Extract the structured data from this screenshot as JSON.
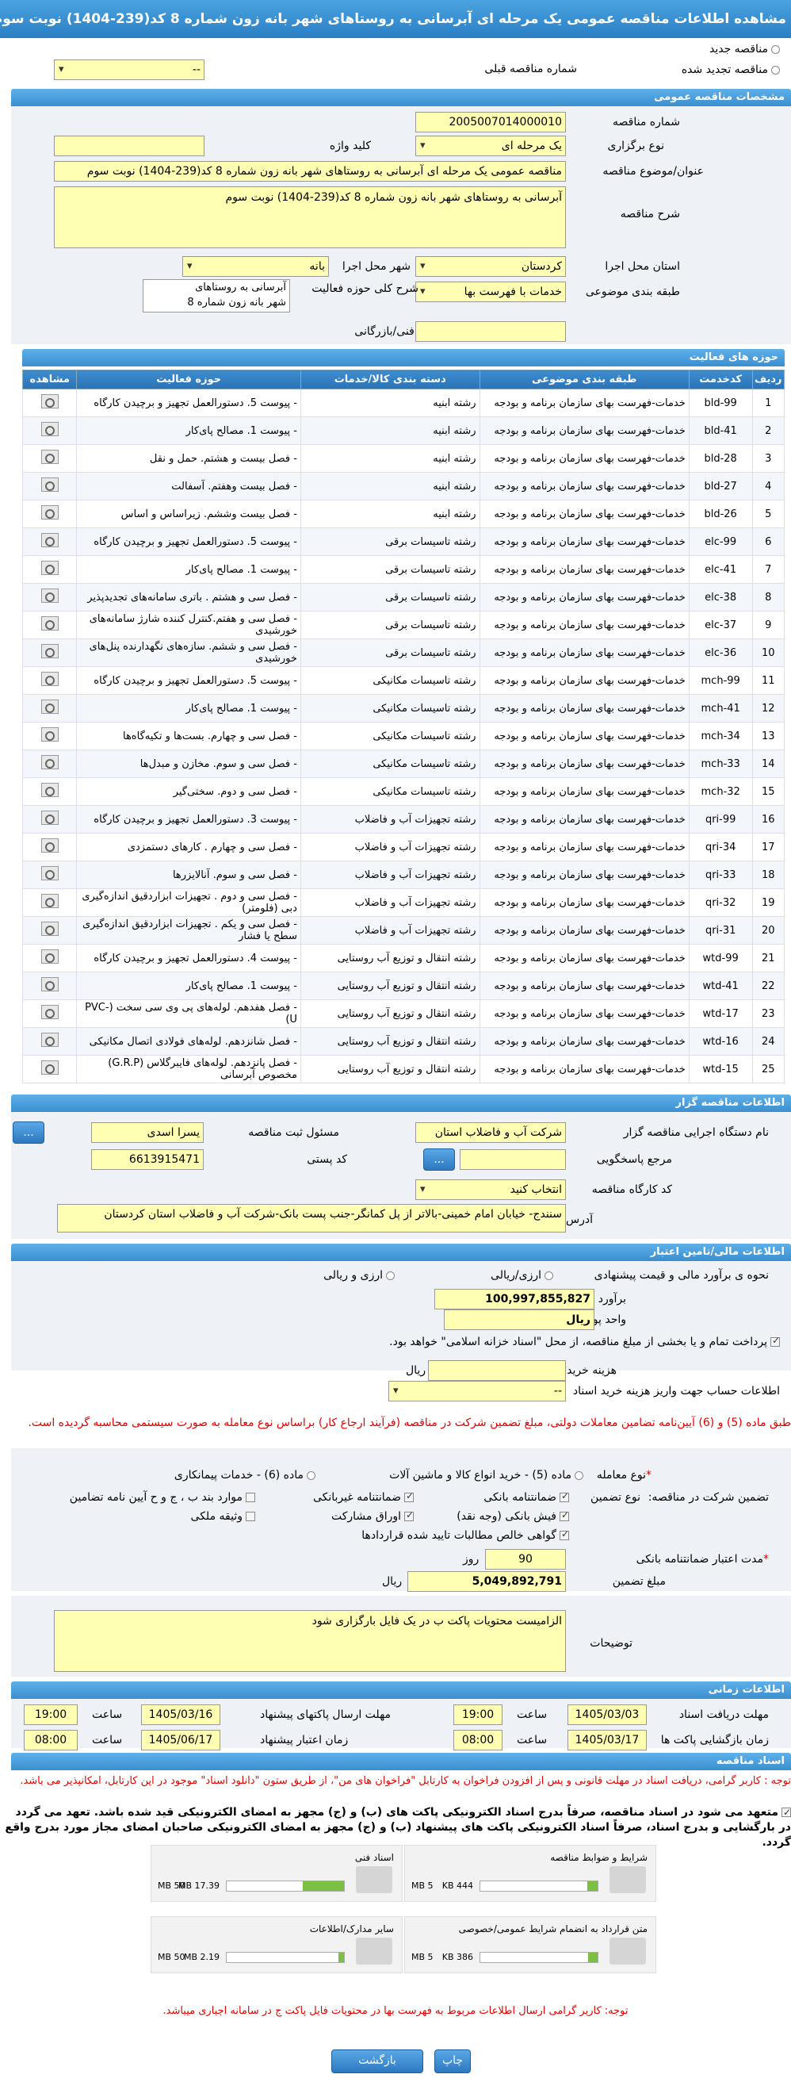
{
  "title": "مشاهده اطلاعات مناقصه عمومی یک مرحله ای آبرسانی به روستاهای شهر بانه زون شماره 8 کد(239-1404) نوبت سوم",
  "top": {
    "new_tender": "مناقصه جدید",
    "renewed_tender": "مناقصه تجدید شده",
    "prev_tender_label": "شماره مناقصه قبلی",
    "prev_tender_value": "--"
  },
  "general": {
    "section_title": "مشخصات مناقصه عمومی",
    "tender_number_label": "شماره مناقصه",
    "tender_number": "2005007014000010",
    "holding_type_label": "نوع برگزاری",
    "holding_type": "یک مرحله ای",
    "keyword_label": "کلید واژه",
    "keyword": "",
    "title_label": "عنوان/موضوع مناقصه",
    "title_value": "مناقصه عمومی یک مرحله ای آبرسانی به روستاهای شهر بانه زون شماره 8 کد(239-1404) نوبت سوم",
    "desc_label": "شرح مناقصه",
    "desc_value": "آبرسانی به روستاهای شهر بانه زون شماره 8 کد(239-1404) نوبت سوم",
    "province_label": "استان محل اجرا",
    "province": "کردستان",
    "city_label": "شهر محل اجرا",
    "city": "بانه",
    "category_label": "طبقه بندی موضوعی",
    "category": "خدمات با فهرست بها",
    "scope_label": "شرح کلی حوزه فعالیت",
    "scope_line1": "آبرسانی به روستاهای",
    "scope_line2": "شهر بانه زون شماره 8",
    "min_score_label": "حداقل امتیاز قابل قبول ارزیابی فنی/بازرگانی",
    "min_score": ""
  },
  "activities": {
    "section_title": "حوزه های فعالیت",
    "headers": [
      "ردیف",
      "کدخدمت",
      "طبقه بندی موضوعی",
      "دسته بندی کالا/خدمات",
      "حوزه فعالیت",
      "مشاهده"
    ],
    "rows": [
      [
        "1",
        "bld-99",
        "خدمات-فهرست بهای سازمان برنامه و بودجه",
        "رشته ابنیه",
        "- پیوست 5. دستورالعمل تجهیز و برچیدن کارگاه"
      ],
      [
        "2",
        "bld-41",
        "خدمات-فهرست بهای سازمان برنامه و بودجه",
        "رشته ابنیه",
        "- پیوست 1. مصالح پای‌کار"
      ],
      [
        "3",
        "bld-28",
        "خدمات-فهرست بهای سازمان برنامه و بودجه",
        "رشته ابنیه",
        "- فصل بیست و هشتم. حمل و نقل"
      ],
      [
        "4",
        "bld-27",
        "خدمات-فهرست بهای سازمان برنامه و بودجه",
        "رشته ابنیه",
        "- فصل بیست وهفتم. آسفالت"
      ],
      [
        "5",
        "bld-26",
        "خدمات-فهرست بهای سازمان برنامه و بودجه",
        "رشته ابنیه",
        "- فصل بیست وششم. زیراساس و اساس"
      ],
      [
        "6",
        "elc-99",
        "خدمات-فهرست بهای سازمان برنامه و بودجه",
        "رشته تاسیسات برقی",
        "- پیوست 5. دستورالعمل تجهیز و برچیدن کارگاه"
      ],
      [
        "7",
        "elc-41",
        "خدمات-فهرست بهای سازمان برنامه و بودجه",
        "رشته تاسیسات برقی",
        "- پیوست 1. مصالح پای‌کار"
      ],
      [
        "8",
        "elc-38",
        "خدمات-فهرست بهای سازمان برنامه و بودجه",
        "رشته تاسیسات برقی",
        "- فصل سی و هشتم . باتری سامانه‌های تجدیدپذیر"
      ],
      [
        "9",
        "elc-37",
        "خدمات-فهرست بهای سازمان برنامه و بودجه",
        "رشته تاسیسات برقی",
        "- فصل سی و هفتم.کنترل کننده شارژ سامانه‌های خورشیدی"
      ],
      [
        "10",
        "elc-36",
        "خدمات-فهرست بهای سازمان برنامه و بودجه",
        "رشته تاسیسات برقی",
        "- فصل سی و ششم. سازه‌های نگهدارنده پنل‌های خورشیدی"
      ],
      [
        "11",
        "mch-99",
        "خدمات-فهرست بهای سازمان برنامه و بودجه",
        "رشته تاسیسات مکانیکی",
        "- پیوست 5. دستورالعمل تجهیز و برچیدن کارگاه"
      ],
      [
        "12",
        "mch-41",
        "خدمات-فهرست بهای سازمان برنامه و بودجه",
        "رشته تاسیسات مکانیکی",
        "- پیوست 1. مصالح پای‌کار"
      ],
      [
        "13",
        "mch-34",
        "خدمات-فهرست بهای سازمان برنامه و بودجه",
        "رشته تاسیسات مکانیکی",
        "- فصل سی و چهارم. بست‌ها و تکیه‌گاه‌ها"
      ],
      [
        "14",
        "mch-33",
        "خدمات-فهرست بهای سازمان برنامه و بودجه",
        "رشته تاسیسات مکانیکی",
        "- فصل سی و سوم. مخازن و مبدل‌ها"
      ],
      [
        "15",
        "mch-32",
        "خدمات-فهرست بهای سازمان برنامه و بودجه",
        "رشته تاسیسات مکانیکی",
        "- فصل سی و دوم. سختی‌گیر"
      ],
      [
        "16",
        "qri-99",
        "خدمات-فهرست بهای سازمان برنامه و بودجه",
        "رشته تجهیزات آب و فاضلاب",
        "- پیوست 3. دستورالعمل تجهیز و برچیدن کارگاه"
      ],
      [
        "17",
        "qri-34",
        "خدمات-فهرست بهای سازمان برنامه و بودجه",
        "رشته تجهیزات آب و فاضلاب",
        "- فصل سی و چهارم . کارهای دستمزدی"
      ],
      [
        "18",
        "qri-33",
        "خدمات-فهرست بهای سازمان برنامه و بودجه",
        "رشته تجهیزات آب و فاضلاب",
        "- فصل سی و سوم. آنالایزرها"
      ],
      [
        "19",
        "qri-32",
        "خدمات-فهرست بهای سازمان برنامه و بودجه",
        "رشته تجهیزات آب و فاضلاب",
        "- فصل سی و دوم . تجهیزات ابزاردقیق اندازه‌گیری دبی (فلومتر)"
      ],
      [
        "20",
        "qri-31",
        "خدمات-فهرست بهای سازمان برنامه و بودجه",
        "رشته تجهیزات آب و فاضلاب",
        "- فصل سی و یکم . تجهیزات ابزاردقیق اندازه‌گیری سطح یا فشار"
      ],
      [
        "21",
        "wtd-99",
        "خدمات-فهرست بهای سازمان برنامه و بودجه",
        "رشته انتقال و توزیع آب روستایی",
        "- پیوست 4. دستورالعمل تجهیز و برچیدن کارگاه"
      ],
      [
        "22",
        "wtd-41",
        "خدمات-فهرست بهای سازمان برنامه و بودجه",
        "رشته انتقال و توزیع آب روستایی",
        "- پیوست 1. مصالح پای‌کار"
      ],
      [
        "23",
        "wtd-17",
        "خدمات-فهرست بهای سازمان برنامه و بودجه",
        "رشته انتقال و توزیع آب روستایی",
        "- فصل هفدهم. لوله‌های پی وی سی سخت (PVC-U)"
      ],
      [
        "24",
        "wtd-16",
        "خدمات-فهرست بهای سازمان برنامه و بودجه",
        "رشته انتقال و توزیع آب روستایی",
        "- فصل شانزدهم. لوله‌های فولادی اتصال مکانیکی"
      ],
      [
        "25",
        "wtd-15",
        "خدمات-فهرست بهای سازمان برنامه و بودجه",
        "رشته انتقال و توزیع آب روستایی",
        "- فصل پانزدهم. لوله‌های فایبرگلاس (G.R.P) مخصوص آبرسانی"
      ]
    ]
  },
  "organizer": {
    "section_title": "اطلاعات مناقصه گزار",
    "agency_label": "نام دستگاه اجرایی مناقصه گزار",
    "agency": "شرکت آب و فاضلاب استان",
    "registrar_label": "مسئول ثبت مناقصه",
    "registrar": "یسرا اسدی",
    "more_btn": "...",
    "response_ref_label": "مرجع پاسخگویی",
    "response_ref": "",
    "postal_code_label": "کد پستی",
    "postal_code": "6613915471",
    "workshop_label": "کد کارگاه مناقصه",
    "workshop": "انتخاب کنید",
    "address_label": "آدرس",
    "address": "سنندج- خیابان امام خمینی-بالاتر از پل کمانگر-جنب پست بانک-شرکت آب و فاضلاب استان کردستان"
  },
  "finance": {
    "section_title": "اطلاعات مالی/تامین اعتبار",
    "estimate_method_label": "نحوه ی برآورد مالی و قیمت پیشنهادی",
    "opt_rial": "ارزی/ریالی",
    "opt_currency_rial": "ارزی و ریالی",
    "estimate_label": "برآورد مالی",
    "estimate": "100,997,855,827",
    "currency_label": "واحد پول",
    "currency": "ریال",
    "treasury_note": "پرداخت تمام و یا بخشی از مبلغ مناقصه، از محل \"اسناد خزانه اسلامی\" خواهد بود.",
    "doc_cost_label": "هزینه خرید اسناد",
    "doc_cost": "",
    "doc_cost_unit": "ریال",
    "account_label": "اطلاعات حساب جهت واریز هزینه خرید اسناد",
    "account": "--",
    "red_note": "طبق ماده (5) و (6) آیین‌نامه تضامین معاملات دولتی، مبلغ تضمین شرکت در مناقصه (فرآیند ارجاع کار) براساس نوع معامله به صورت سیستمی محاسبه گردیده است.",
    "deal_type_label": "نوع معامله",
    "deal_opt1": "ماده (5) - خرید انواع کالا و ماشین آلات",
    "deal_opt2": "ماده (6) - خدمات پیمانکاری",
    "guarantee_label": "تضمین شرکت در مناقصه:",
    "guarantee_type_label": "نوع تضمین",
    "g1": "ضمانتنامه بانکی",
    "g2": "ضمانتنامه غیربانکی",
    "g3": "موارد بند ب ، ج و ح آیین نامه تضامین",
    "g4": "فیش بانکی (وجه نقد)",
    "g5": "اوراق مشارکت",
    "g6": "وثیقه ملکی",
    "g7": "گواهی خالص مطالبات تایید شده قراردادها",
    "validity_label": "مدت اعتبار ضمانتنامه بانکی",
    "validity": "90",
    "validity_unit": "روز",
    "guarantee_amount_label": "مبلغ تضمین",
    "guarantee_amount": "5,049,892,791",
    "guarantee_unit": "ریال",
    "notes_label": "توضیحات",
    "notes": "الزامیست محتویات پاکت ب در یک فایل بارگزاری شود"
  },
  "timing": {
    "section_title": "اطلاعات زمانی",
    "receive_label": "مهلت دریافت اسناد",
    "receive_date": "1405/03/03",
    "receive_time": "19:00",
    "send_label": "مهلت ارسال پاکتهای پیشنهاد",
    "send_date": "1405/03/16",
    "send_time": "19:00",
    "open_label": "زمان بازگشایی پاکت ها",
    "open_date": "1405/03/17",
    "open_time": "08:00",
    "validity_label": "زمان اعتبار پیشنهاد",
    "validity_date": "1405/06/17",
    "validity_time": "08:00",
    "time_label": "ساعت"
  },
  "docs": {
    "section_title": "اسناد مناقصه",
    "note1": "توجه : کاربر گرامی، دریافت اسناد در مهلت قانونی و پس از افزودن فراخوان به کارتابل \"فراخوان های من\"، از طریق ستون \"دانلود اسناد\" موجود در این کارتابل، امکانپذیر می باشد.",
    "note2": "متعهد می شود در اسناد مناقصه، صرفاً بدرج اسناد الکترونیکی پاکت های (ب) و (ج) مجهز به امضای الکترونیکی قید شده باشد. تعهد می گردد در بارگشایی و بدرج اسناد، صرفاً اسناد الکترونیکی پاکت های پیشنهاد (ب) و (ج) مجهز به امضای الکترونیکی صاحبان امضای مجاز مورد بدرج واقع گردد.",
    "items": [
      {
        "name": "شرایط و ضوابط مناقصه",
        "size": "444 KB",
        "max": "5 MB",
        "fill": 0.09
      },
      {
        "name": "اسناد فنی",
        "size": "17.39 MB",
        "max": "50 MB",
        "fill": 0.35
      },
      {
        "name": "متن قرارداد به انضمام شرایط عمومی/خصوصی",
        "size": "386 KB",
        "max": "5 MB",
        "fill": 0.08
      },
      {
        "name": "سایر مدارک/اطلاعات",
        "size": "2.19 MB",
        "max": "50 MB",
        "fill": 0.05
      }
    ],
    "red_note": "توجه: کاربر گرامی ارسال اطلاعات مربوط به فهرست بها در محتویات فایل پاکت ج در سامانه اجباری میباشد."
  },
  "buttons": {
    "print": "چاپ",
    "back": "بازگشت"
  }
}
